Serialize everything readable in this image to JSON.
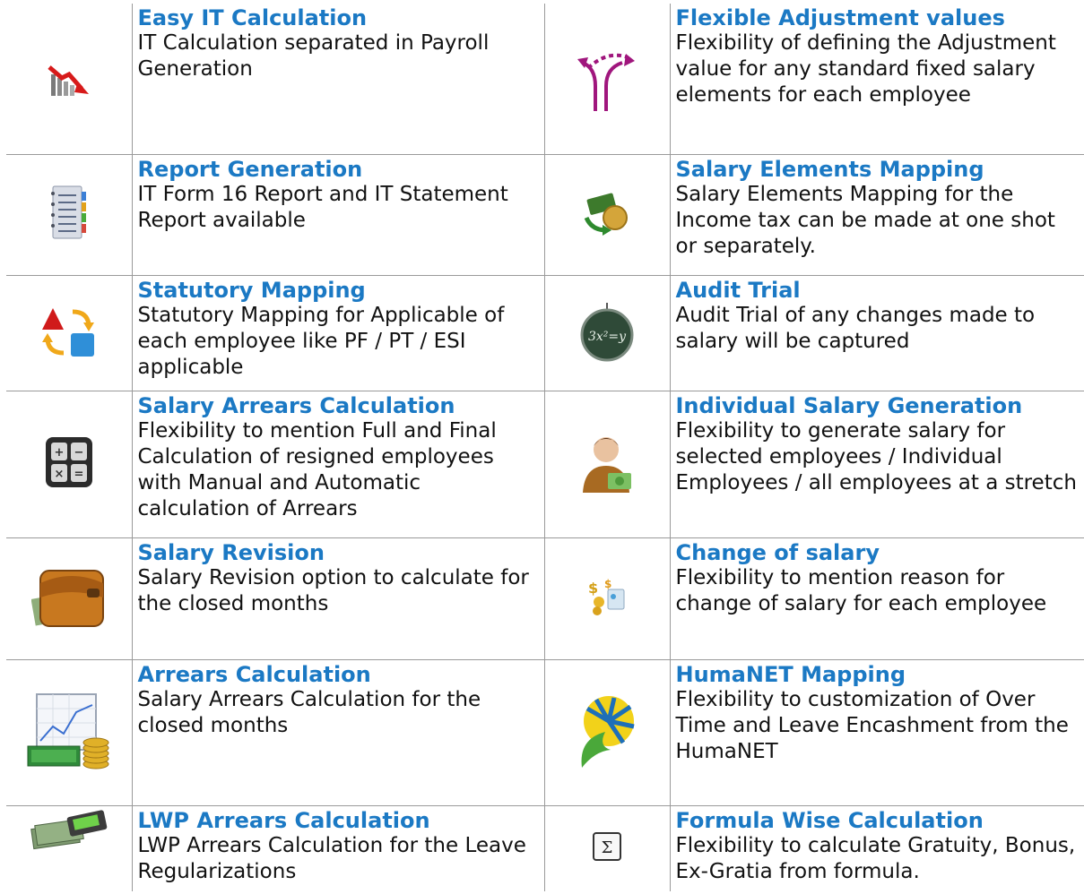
{
  "rows": [
    {
      "left": {
        "icon": "declining-chart-icon",
        "title": "Easy IT Calculation",
        "desc": "IT Calculation separated in Payroll Generation"
      },
      "right": {
        "icon": "branching-arrows-icon",
        "title": "Flexible Adjustment values",
        "desc": "Flexibility of defining the Adjustment value for any standard fixed salary elements for each employee"
      }
    },
    {
      "left": {
        "icon": "notebook-report-icon",
        "title": "Report Generation",
        "desc": "IT Form 16 Report and IT Statement Report available"
      },
      "right": {
        "icon": "money-mapping-icon",
        "title": "Salary Elements Mapping",
        "desc": "Salary Elements Mapping for the Income tax can be made at one shot or separately."
      }
    },
    {
      "left": {
        "icon": "shapes-mapping-icon",
        "title": "Statutory Mapping",
        "desc": "Statutory Mapping for Applicable of each employee like PF / PT / ESI applicable"
      },
      "right": {
        "icon": "formula-board-icon",
        "title": "Audit Trial",
        "desc": "Audit Trial of any changes made to salary will be captured"
      }
    },
    {
      "left": {
        "icon": "calculator-icon",
        "title": "Salary Arrears Calculation",
        "desc": "Flexibility to mention Full and Final Calculation of resigned employees with Manual and Automatic calculation of Arrears"
      },
      "right": {
        "icon": "person-money-icon",
        "title": "Individual Salary Generation",
        "desc": "Flexibility to generate salary for selected employees / Individual Employees / all employees at a stretch"
      }
    },
    {
      "left": {
        "icon": "wallet-icon",
        "title": "Salary Revision",
        "desc": "Salary Revision option to calculate for the closed months"
      },
      "right": {
        "icon": "coins-change-icon",
        "title": "Change of salary",
        "desc": "Flexibility to mention reason for change of salary for each employee"
      }
    },
    {
      "left": {
        "icon": "chart-money-icon",
        "title": "Arrears Calculation",
        "desc": "Salary Arrears Calculation for the closed months"
      },
      "right": {
        "icon": "humanet-logo-icon",
        "title": "HumaNET Mapping",
        "desc": "Flexibility to customization of Over Time and Leave Encashment from the HumaNET"
      }
    },
    {
      "left": {
        "icon": "cash-terminal-icon",
        "title": "LWP Arrears Calculation",
        "desc": "LWP Arrears Calculation for the Leave Regularizations"
      },
      "right": {
        "icon": "sigma-icon",
        "title": "Formula Wise Calculation",
        "desc": "Flexibility to calculate Gratuity, Bonus, Ex-Gratia from formula."
      }
    }
  ]
}
